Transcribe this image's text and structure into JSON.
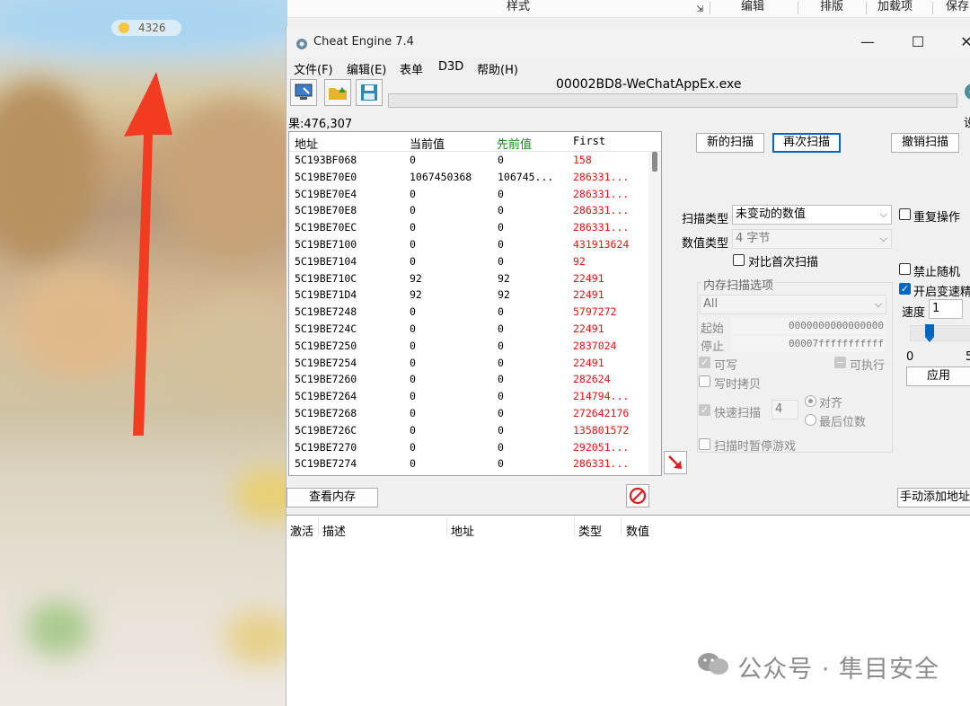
{
  "game": {
    "score": "4326"
  },
  "top_strip": {
    "items": [
      "样式",
      "编辑",
      "排版",
      "加载项",
      "保存"
    ]
  },
  "window": {
    "title": "Cheat Engine 7.4",
    "minimize": "—",
    "maximize": "☐",
    "close": "✕"
  },
  "menu": {
    "items": [
      "文件(F)",
      "编辑(E)",
      "表单",
      "D3D",
      "帮助(H)"
    ]
  },
  "toolbar": {
    "process": "00002BD8-WeChatAppEx.exe",
    "settings_label": "设"
  },
  "results": {
    "found_label": "果:476,307",
    "headers": {
      "address": "地址",
      "current": "当前值",
      "previous": "先前值",
      "first": "First"
    },
    "rows": [
      {
        "address": "5C193BF068",
        "current": "0",
        "previous": "0",
        "first": "158"
      },
      {
        "address": "5C19BE70E0",
        "current": "1067450368",
        "previous": "106745...",
        "first": "286331..."
      },
      {
        "address": "5C19BE70E4",
        "current": "0",
        "previous": "0",
        "first": "286331..."
      },
      {
        "address": "5C19BE70E8",
        "current": "0",
        "previous": "0",
        "first": "286331..."
      },
      {
        "address": "5C19BE70EC",
        "current": "0",
        "previous": "0",
        "first": "286331..."
      },
      {
        "address": "5C19BE7100",
        "current": "0",
        "previous": "0",
        "first": "431913624"
      },
      {
        "address": "5C19BE7104",
        "current": "0",
        "previous": "0",
        "first": "92"
      },
      {
        "address": "5C19BE710C",
        "current": "92",
        "previous": "92",
        "first": "22491"
      },
      {
        "address": "5C19BE71D4",
        "current": "92",
        "previous": "92",
        "first": "22491"
      },
      {
        "address": "5C19BE7248",
        "current": "0",
        "previous": "0",
        "first": "5797272"
      },
      {
        "address": "5C19BE724C",
        "current": "0",
        "previous": "0",
        "first": "22491"
      },
      {
        "address": "5C19BE7250",
        "current": "0",
        "previous": "0",
        "first": "2837024"
      },
      {
        "address": "5C19BE7254",
        "current": "0",
        "previous": "0",
        "first": "22491"
      },
      {
        "address": "5C19BE7260",
        "current": "0",
        "previous": "0",
        "first": "282624"
      },
      {
        "address": "5C19BE7264",
        "current": "0",
        "previous": "0",
        "first": "214794..."
      },
      {
        "address": "5C19BE7268",
        "current": "0",
        "previous": "0",
        "first": "272642176"
      },
      {
        "address": "5C19BE726C",
        "current": "0",
        "previous": "0",
        "first": "135801572"
      },
      {
        "address": "5C19BE7270",
        "current": "0",
        "previous": "0",
        "first": "292051..."
      },
      {
        "address": "5C19BE7274",
        "current": "0",
        "previous": "0",
        "first": "286331..."
      }
    ]
  },
  "scan": {
    "new_scan": "新的扫描",
    "next_scan": "再次扫描",
    "undo_scan": "撤销扫描",
    "scan_type_label": "扫描类型",
    "scan_type_value": "未变动的数值",
    "value_type_label": "数值类型",
    "value_type_value": "4 字节",
    "compare_first": "对比首次扫描",
    "repeat": "重复操作",
    "disable_random": "禁止随机",
    "speedhack": "开启变速精",
    "speed_label": "速度",
    "speed_value": "1",
    "slider_min": "0",
    "slider_max": "5",
    "apply": "应用",
    "mem_options_title": "内存扫描选项",
    "region_value": "All",
    "start_label": "起始",
    "start_value": "0000000000000000",
    "stop_label": "停止",
    "stop_value": "00007fffffffffff",
    "writable": "可写",
    "executable": "可执行",
    "copy_on_write": "写时拷贝",
    "fast_scan": "快速扫描",
    "fast_scan_value": "4",
    "align": "对齐",
    "last_digits": "最后位数",
    "pause_game": "扫描时暂停游戏"
  },
  "bottom_bar": {
    "view_memory": "查看内存",
    "add_manual": "手动添加地址"
  },
  "address_list": {
    "headers": [
      "激活",
      "描述",
      "地址",
      "类型",
      "数值"
    ]
  },
  "watermark": {
    "text": "公众号 · 隼目安全"
  }
}
